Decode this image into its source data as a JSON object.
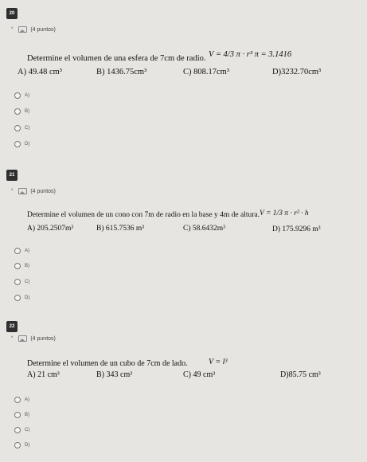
{
  "questions": [
    {
      "number": "20",
      "points": "(4 puntos)",
      "stem": "Determine el volumen de una esfera de 7cm de radio.",
      "formula": "V = 4/3 π · r³   π = 3.1416",
      "options": [
        {
          "letter": "A)",
          "value": "49.48 cm³"
        },
        {
          "letter": "B)",
          "value": "1436.75cm³"
        },
        {
          "letter": "C)",
          "value": "808.17cm³"
        },
        {
          "letter": "D)",
          "value": "3232.70cm³"
        }
      ],
      "choices": [
        "A)",
        "B)",
        "C)",
        "D)"
      ]
    },
    {
      "number": "21",
      "points": "(4 puntos)",
      "stem": "Determine el volumen de un cono con 7m de radio en la base y 4m de altura.",
      "formula": "V = 1/3 π · r² · h",
      "options": [
        {
          "letter": "A)",
          "value": "205.2507m³"
        },
        {
          "letter": "B)",
          "value": "615.7536 m³"
        },
        {
          "letter": "C)",
          "value": "58.6432m³"
        },
        {
          "letter": "D)",
          "value": "175.9296 m³"
        }
      ],
      "choices": [
        "A)",
        "B)",
        "C)",
        "D)"
      ]
    },
    {
      "number": "22",
      "points": "(4 puntos)",
      "stem": "Determine el volumen de un cubo de 7cm de lado.",
      "formula": "V = l³",
      "options": [
        {
          "letter": "A)",
          "value": "21 cm³"
        },
        {
          "letter": "B)",
          "value": "343 cm³"
        },
        {
          "letter": "C)",
          "value": "49 cm³"
        },
        {
          "letter": "D)",
          "value": "85.75 cm³"
        }
      ],
      "choices": [
        "A)",
        "B)",
        "C)",
        "D)"
      ]
    }
  ]
}
